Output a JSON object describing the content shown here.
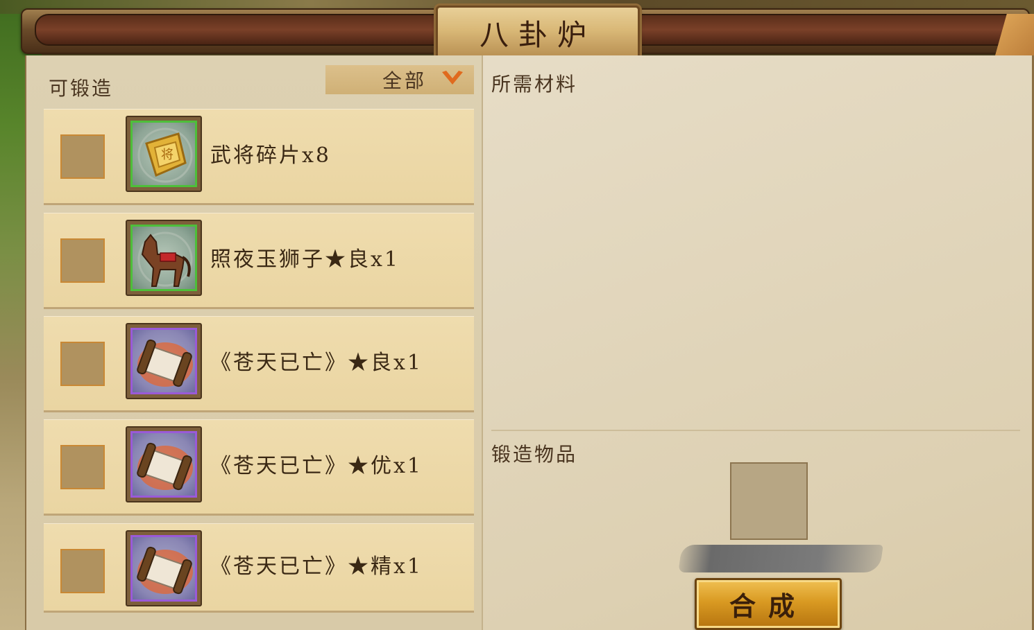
{
  "window": {
    "title": "八卦炉"
  },
  "left_panel": {
    "heading": "可锻造",
    "filter": {
      "selected": "全部"
    },
    "items": [
      {
        "name": "武将碎片x8",
        "rarity": "green",
        "icon": "general-shard-icon"
      },
      {
        "name": "照夜玉狮子★良x1",
        "rarity": "green",
        "icon": "horse-icon"
      },
      {
        "name": "《苍天已亡》★良x1",
        "rarity": "purple",
        "icon": "scroll-icon"
      },
      {
        "name": "《苍天已亡》★优x1",
        "rarity": "purple",
        "icon": "scroll-icon"
      },
      {
        "name": "《苍天已亡》★精x1",
        "rarity": "purple",
        "icon": "scroll-icon"
      }
    ]
  },
  "right_panel": {
    "materials_heading": "所需材料",
    "result_heading": "锻造物品",
    "craft_button": "合成"
  },
  "colors": {
    "green_frame": "#4dbf3a",
    "purple_frame": "#9a5ad8",
    "accent_orange": "#e06a1e",
    "button_gold": "#d99a22"
  }
}
